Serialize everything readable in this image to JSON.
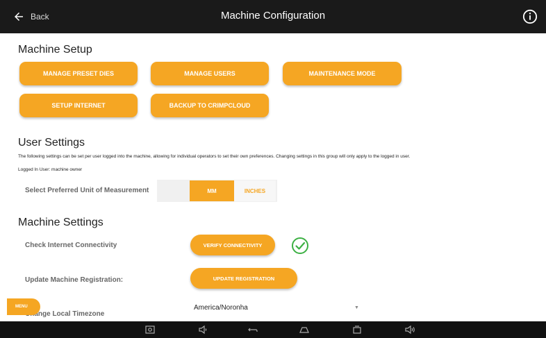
{
  "header": {
    "back_label": "Back",
    "title": "Machine Configuration",
    "info_icon": "info-icon"
  },
  "machine_setup": {
    "title": "Machine Setup",
    "buttons": [
      "MANAGE PRESET DIES",
      "MANAGE USERS",
      "MAINTENANCE MODE",
      "SETUP INTERNET",
      "BACKUP TO CRIMPCLOUD"
    ]
  },
  "user_settings": {
    "title": "User Settings",
    "description": "The following settings can be set per user logged into the machine, allowing for individual operators to set their own preferences. Changing settings in this group will only apply to the logged in user.",
    "logged_in": "Logged In User: machine owner",
    "unit_label": "Select Preferred Unit of Measurement",
    "units": [
      "MM",
      "INCHES"
    ],
    "selected_unit": "MM"
  },
  "machine_settings": {
    "title": "Machine Settings",
    "connectivity_label": "Check Internet Connectivity",
    "connectivity_button": "VERIFY CONNECTIVITY",
    "connectivity_status_icon": "check-circle-icon",
    "registration_label": "Update Machine Registration:",
    "registration_button": "UPDATE REGISTRATION",
    "timezone_label": "Change Local Timezone",
    "timezone_value": "America/Noronha"
  },
  "menu": {
    "label": "MENU"
  },
  "navbar": {
    "icons": [
      "screenshot-icon",
      "volume-down-icon",
      "back-nav-icon",
      "home-icon",
      "recent-apps-icon",
      "volume-up-icon"
    ]
  },
  "colors": {
    "accent": "#f5a623",
    "topbar": "#1a1a1a",
    "success": "#3cb043"
  }
}
